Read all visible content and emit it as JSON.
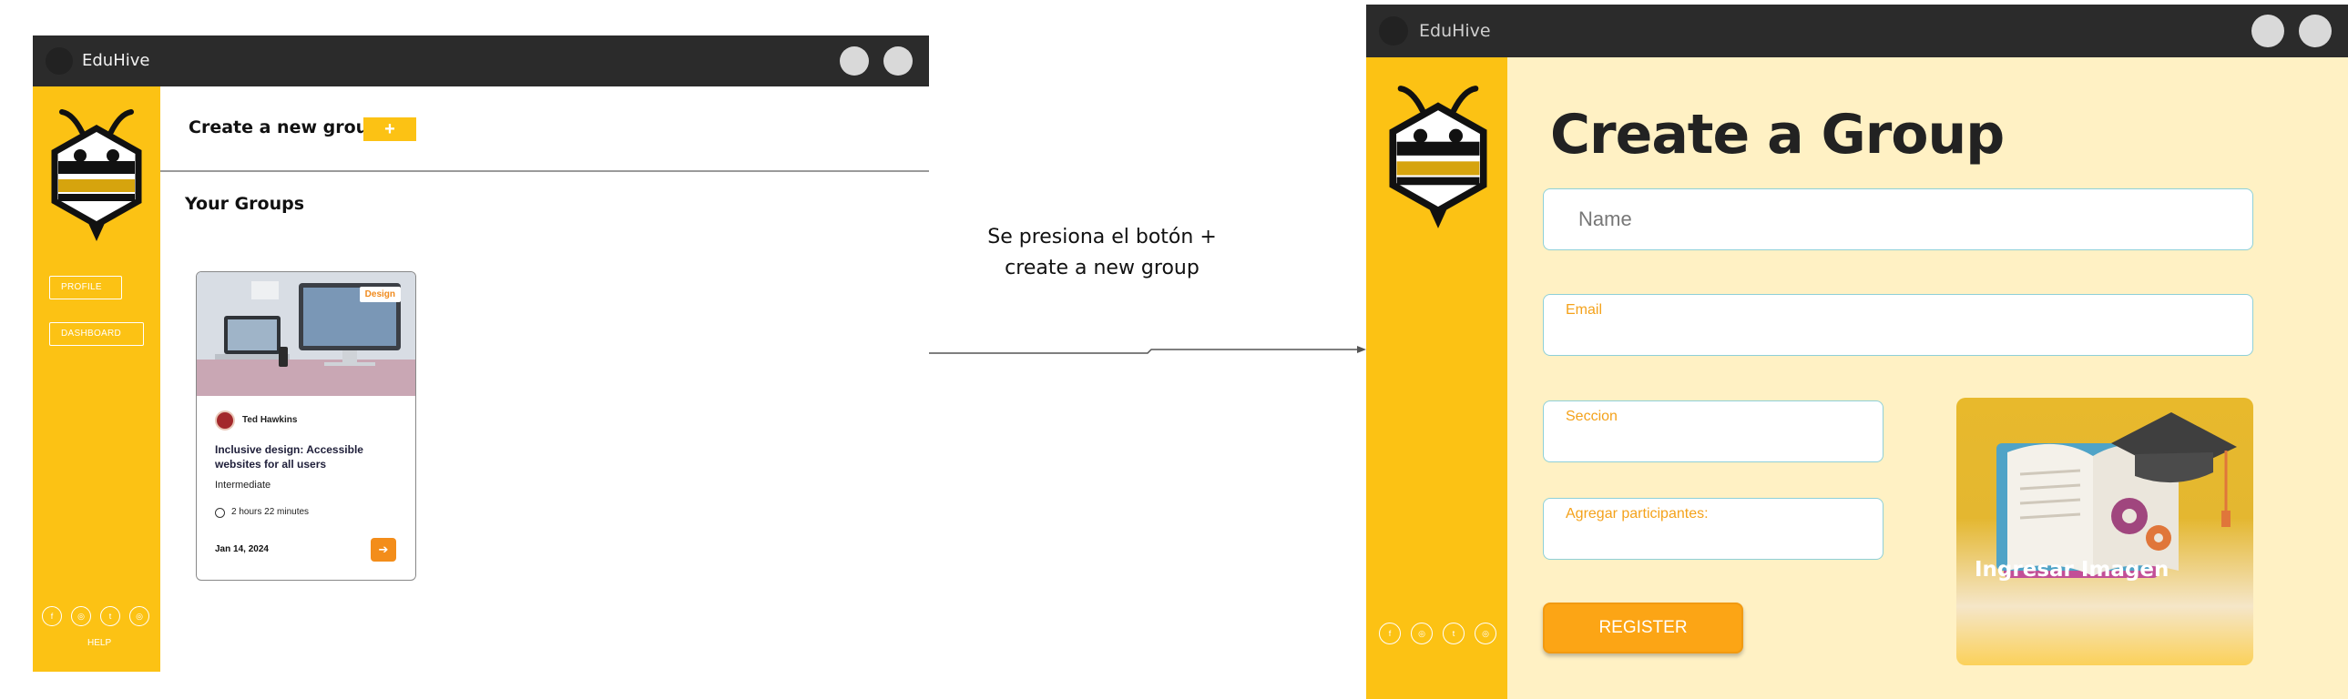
{
  "left_window": {
    "app_title": "EduHive",
    "sidebar": {
      "items": [
        {
          "label": "PROFILE"
        },
        {
          "label": "DASHBOARD"
        }
      ],
      "social_icons": [
        "facebook-icon",
        "instagram-icon",
        "twitter-icon",
        "instagram-icon"
      ],
      "help_label": "HELP"
    },
    "header": {
      "create_label": "Create a new group",
      "plus_label": "+"
    },
    "section_title": "Your Groups",
    "card": {
      "badge": "Design",
      "author": "Ted Hawkins",
      "title": "Inclusive design: Accessible websites for all users",
      "level": "Intermediate",
      "duration": "2 hours 22 minutes",
      "date": "Jan 14, 2024",
      "go_icon": "arrow-right-icon"
    }
  },
  "caption": {
    "line1": "Se presiona el botón +",
    "line2": "create a new group"
  },
  "right_window": {
    "app_title": "EduHive",
    "title": "Create a Group",
    "fields": {
      "name_placeholder": "Name",
      "email_label": "Email",
      "seccion_label": "Seccion",
      "participants_label": "Agregar participantes:"
    },
    "register_label": "REGISTER",
    "image_label": "Ingresar Imagen",
    "social_icons": [
      "facebook-icon",
      "instagram-icon",
      "twitter-icon",
      "instagram-icon"
    ]
  },
  "colors": {
    "brand_yellow": "#fcc214",
    "titlebar": "#2b2b2b",
    "accent_orange": "#f38d1a",
    "form_bg": "#fff1c4",
    "field_border": "#8ed0d8"
  }
}
